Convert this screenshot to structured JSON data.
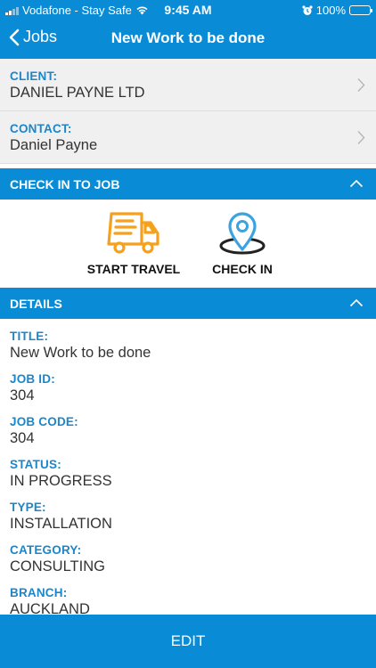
{
  "status_bar": {
    "carrier": "Vodafone - Stay Safe",
    "time": "9:45 AM",
    "battery": "100%",
    "battery_level": 1.0
  },
  "nav": {
    "back_label": "Jobs",
    "title": "New Work to be done"
  },
  "client": {
    "label": "CLIENT:",
    "value": "DANIEL PAYNE LTD"
  },
  "contact": {
    "label": "CONTACT:",
    "value": "Daniel Payne"
  },
  "checkin_section": {
    "header": "CHECK IN TO JOB",
    "start_travel": "START TRAVEL",
    "check_in": "CHECK IN"
  },
  "details_section": {
    "header": "DETAILS",
    "fields": [
      {
        "label": "TITLE:",
        "value": "New Work to be done"
      },
      {
        "label": "JOB ID:",
        "value": "304"
      },
      {
        "label": "JOB CODE:",
        "value": "304"
      },
      {
        "label": "STATUS:",
        "value": "IN PROGRESS"
      },
      {
        "label": "TYPE:",
        "value": "INSTALLATION"
      },
      {
        "label": "CATEGORY:",
        "value": "CONSULTING"
      },
      {
        "label": "BRANCH:",
        "value": "AUCKLAND"
      }
    ]
  },
  "edit_button": "EDIT",
  "colors": {
    "brand_blue": "#0a8bd6",
    "label_blue": "#1c86c8",
    "travel_orange": "#f5a11c",
    "checkin_blue": "#3aa3e0"
  },
  "icons": [
    "signal-icon",
    "wifi-icon",
    "alarm-icon",
    "battery-icon",
    "back-chevron-icon",
    "chevron-right-icon",
    "chevron-up-icon",
    "truck-icon",
    "location-pin-icon"
  ]
}
